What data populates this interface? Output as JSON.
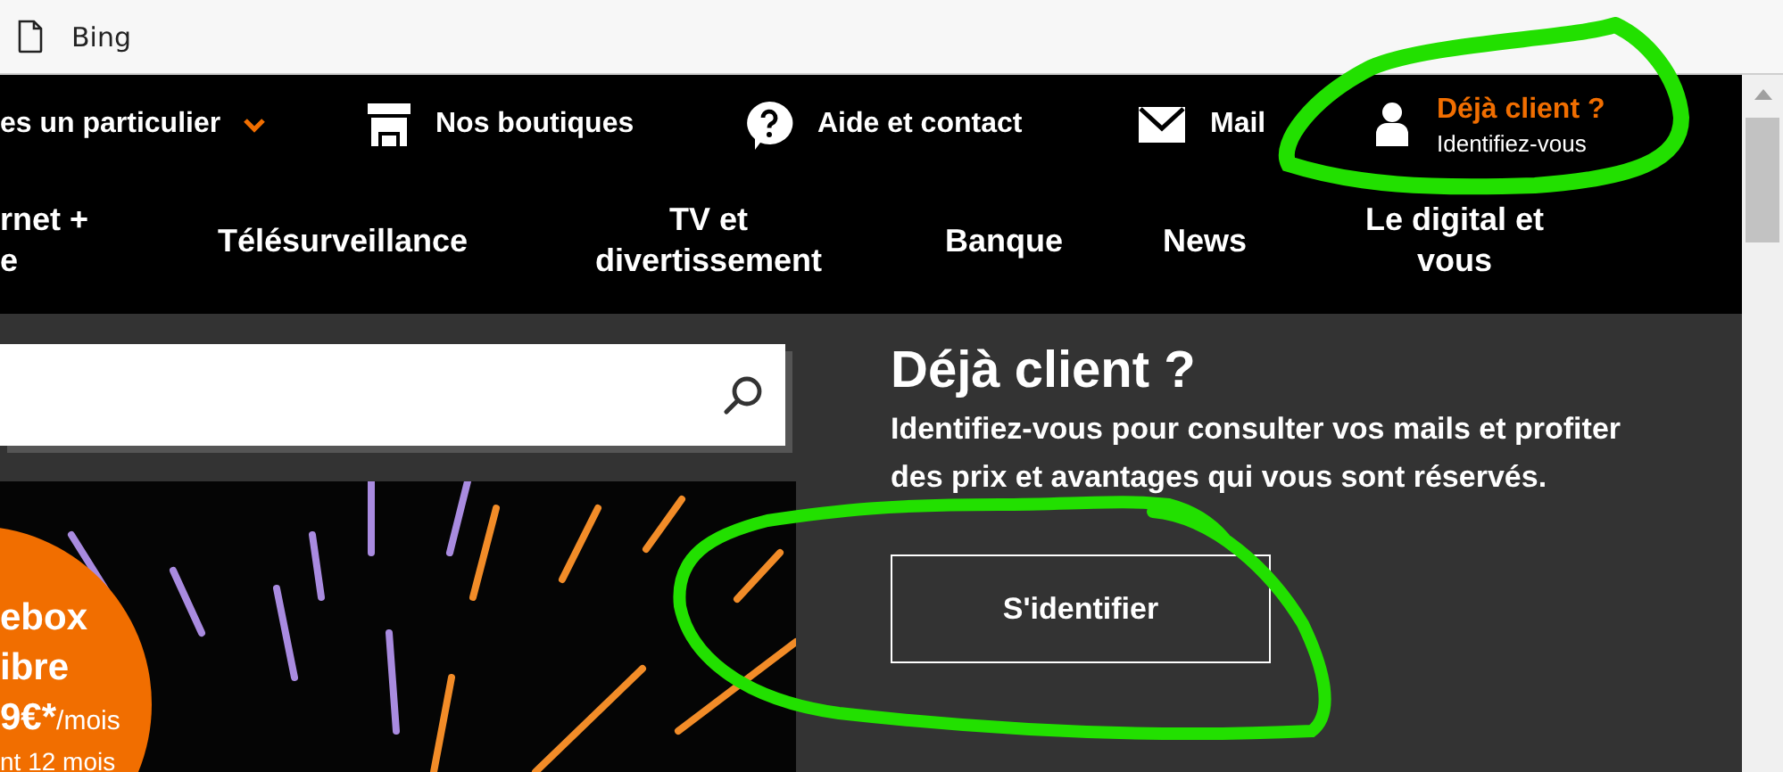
{
  "browser_tab": {
    "title": "Bing"
  },
  "top_bar": {
    "items": [
      {
        "kind": "dropdown",
        "label": "es un particulier"
      },
      {
        "kind": "shop",
        "label": "Nos boutiques"
      },
      {
        "kind": "help",
        "label": "Aide et contact"
      },
      {
        "kind": "mail",
        "label": "Mail"
      }
    ],
    "account": {
      "title": "Déjà client ?",
      "subtitle": "Identifiez-vous"
    }
  },
  "nav": {
    "items": [
      {
        "lines": [
          "rnet +",
          "e"
        ]
      },
      {
        "lines": [
          "Télésurveillance"
        ]
      },
      {
        "lines": [
          "TV et",
          "divertissement"
        ]
      },
      {
        "lines": [
          "Banque"
        ]
      },
      {
        "lines": [
          "News"
        ]
      },
      {
        "lines": [
          "Le digital et",
          "vous"
        ]
      }
    ]
  },
  "promo": {
    "badge_lines": [
      "ebox",
      "ibre"
    ],
    "price": "9€*",
    "price_unit": "/mois",
    "footnote": "nt 12 mois"
  },
  "login_panel": {
    "title": "Déjà client ?",
    "text": "Identifiez-vous pour consulter vos mails et profiter des prix et avantages qui vous sont réservés.",
    "button": "S'identifier"
  }
}
